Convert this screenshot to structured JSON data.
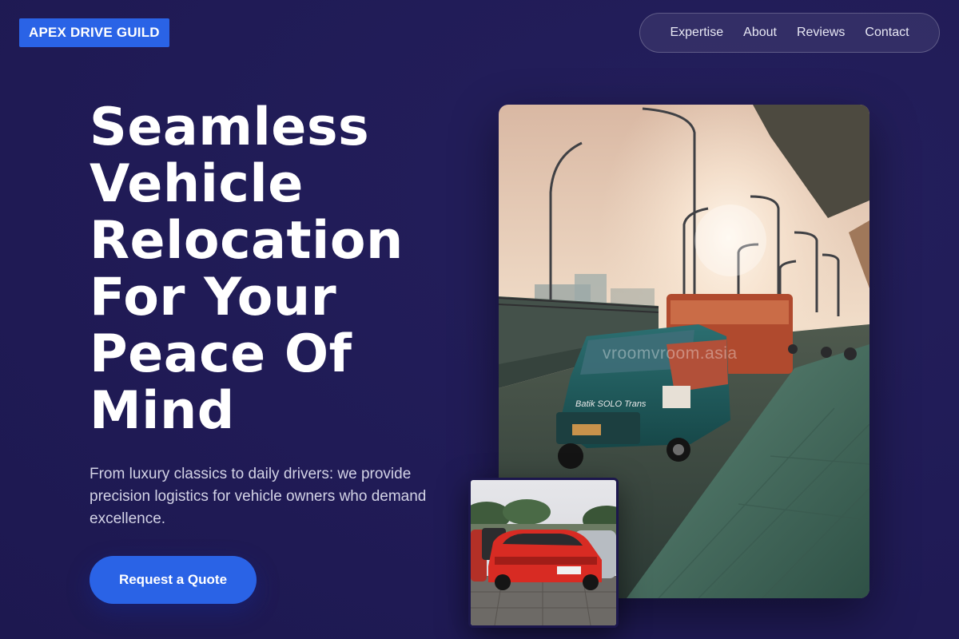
{
  "header": {
    "logo": "APEX DRIVE GUILD",
    "nav": [
      "Expertise",
      "About",
      "Reviews",
      "Contact"
    ]
  },
  "hero": {
    "title_lines": [
      "Seamless",
      "Vehicle",
      "Relocation",
      "For Your",
      "Peace Of",
      "Mind"
    ],
    "subtitle": "From luxury classics to daily drivers: we provide precision logistics for vehicle owners who demand excellence.",
    "cta": "Request a Quote"
  },
  "images": {
    "main_watermark": "vroomvroom.asia",
    "van_sign": "Batik SOLO Trans"
  },
  "colors": {
    "background": "#201b56",
    "accent": "#2a63e6",
    "text_muted": "#d3d3e6"
  }
}
